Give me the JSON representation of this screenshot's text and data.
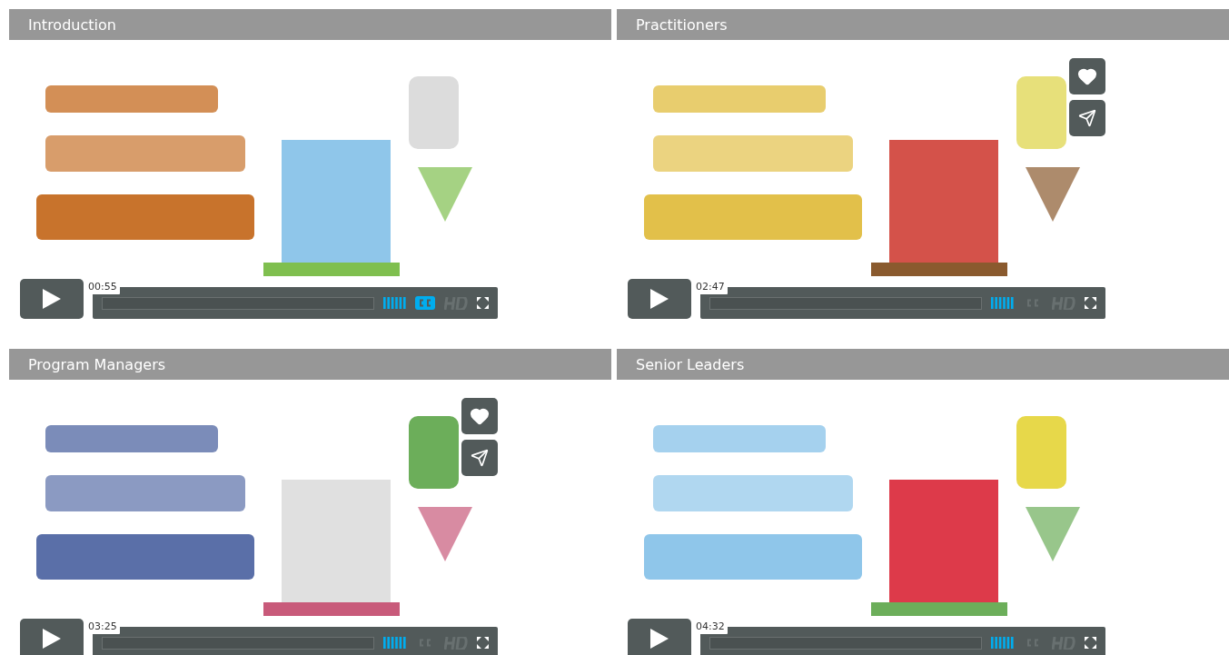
{
  "videos": [
    {
      "title": "Introduction",
      "time": "00:55",
      "captions": true,
      "actions_shown": false
    },
    {
      "title": "Practitioners",
      "time": "02:47",
      "captions": false,
      "actions_shown": true
    },
    {
      "title": "Program Managers",
      "time": "03:25",
      "captions": false,
      "actions_shown": true
    },
    {
      "title": "Senior Leaders",
      "time": "04:32",
      "captions": false,
      "actions_shown": false
    }
  ]
}
